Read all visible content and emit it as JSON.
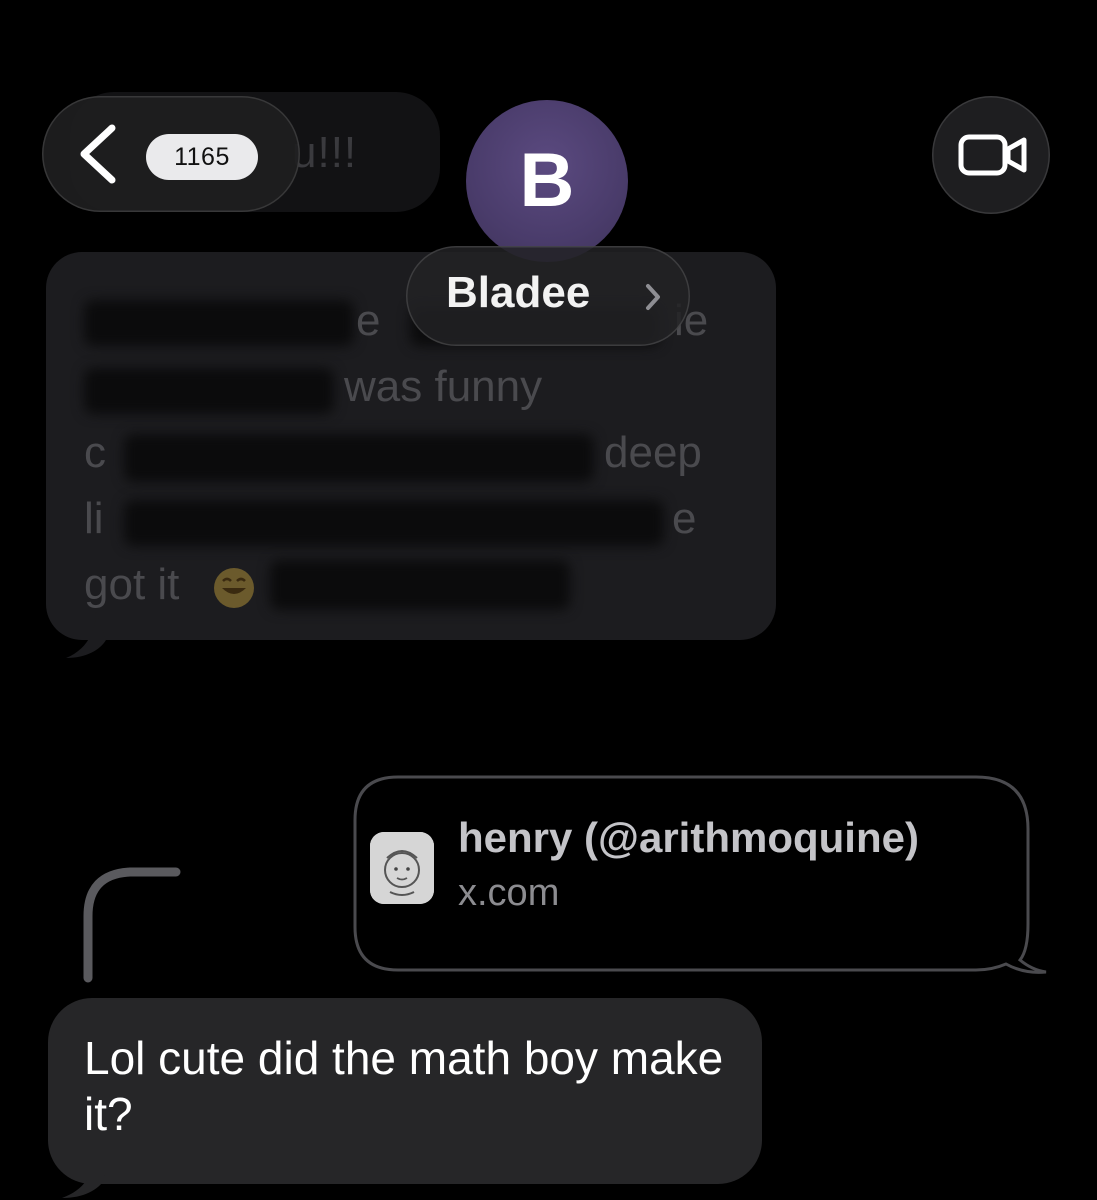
{
  "header": {
    "back_badge": "1165",
    "avatar_initial": "B",
    "contact_name": "Bladee"
  },
  "background_messages": {
    "top_fragment": "u!!!",
    "big_fragments": [
      "e",
      "ie",
      "was funny",
      "c",
      "deep",
      "li",
      "e",
      "got it"
    ]
  },
  "link_preview": {
    "title": "henry (@arithmoquine)",
    "domain": "x.com"
  },
  "received_message": {
    "text": "Lol cute did the math boy make it?"
  },
  "icons": {
    "back": "chevron-left-icon",
    "video": "video-camera-icon",
    "name_chevron": "chevron-right-icon"
  },
  "colors": {
    "background": "#000000",
    "received_bubble": "#262628",
    "avatar": "#4a3c6b",
    "badge": "#eaeaec"
  }
}
